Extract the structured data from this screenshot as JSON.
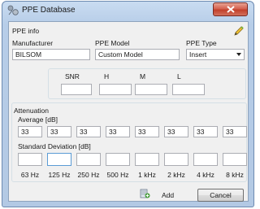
{
  "window": {
    "title": "PPE Database"
  },
  "ppe_info": {
    "section_label": "PPE info",
    "manufacturer_label": "Manufacturer",
    "manufacturer_value": "BILSOM",
    "model_label": "PPE Model",
    "model_value": "Custom Model",
    "type_label": "PPE Type",
    "type_value": "Insert"
  },
  "ratings": {
    "snr_label": "SNR",
    "h_label": "H",
    "m_label": "M",
    "l_label": "L"
  },
  "attenuation": {
    "section_label": "Attenuation",
    "average_label": "Average [dB]",
    "average_values": [
      "33",
      "33",
      "33",
      "33",
      "33",
      "33",
      "33",
      "33"
    ],
    "std_label": "Standard Deviation [dB]",
    "frequencies": [
      "63 Hz",
      "125 Hz",
      "250 Hz",
      "500 Hz",
      "1 kHz",
      "2 kHz",
      "4 kHz",
      "8 kHz"
    ]
  },
  "actions": {
    "add_label": "Add",
    "cancel_label": "Cancel"
  },
  "icons": {
    "app": "ppe-database-icon",
    "close": "close-icon",
    "edit": "pencil-icon",
    "add": "add-icon"
  }
}
